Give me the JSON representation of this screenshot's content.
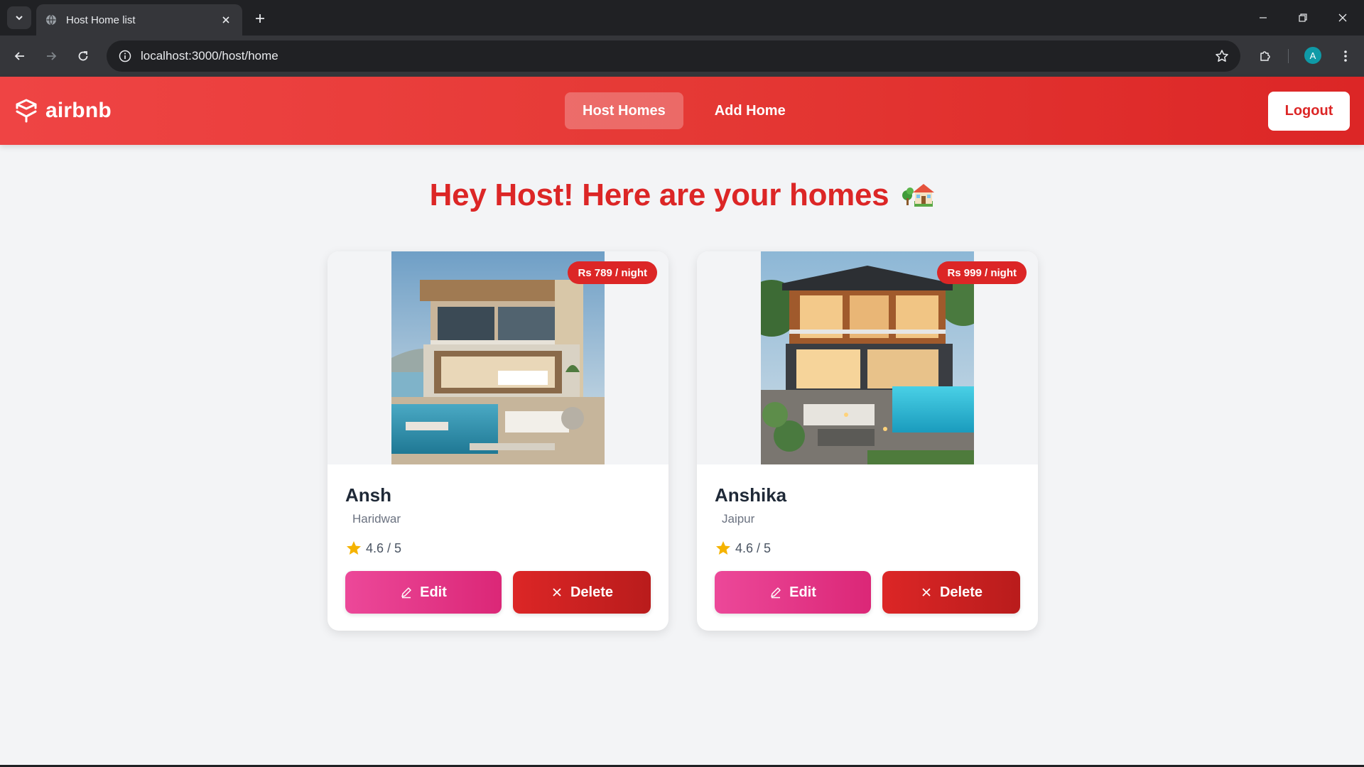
{
  "browser": {
    "tab_title": "Host Home list",
    "url": "localhost:3000/host/home",
    "profile_initial": "A"
  },
  "header": {
    "brand": "airbnb",
    "nav": [
      {
        "label": "Host Homes",
        "active": true
      },
      {
        "label": "Add Home",
        "active": false
      }
    ],
    "logout_label": "Logout"
  },
  "page": {
    "title": "Hey Host! Here are your homes",
    "title_emoji_icon": "house-with-garden-icon"
  },
  "homes": [
    {
      "name": "Ansh",
      "location": "Haridwar",
      "price_label": "Rs 789 / night",
      "rating_label": "4.6 / 5",
      "edit_label": "Edit",
      "delete_label": "Delete"
    },
    {
      "name": "Anshika",
      "location": "Jaipur",
      "price_label": "Rs 999 / night",
      "rating_label": "4.6 / 5",
      "edit_label": "Edit",
      "delete_label": "Delete"
    }
  ],
  "colors": {
    "brand_red": "#dc2626",
    "edit_pink": "#ec4899",
    "star_gold": "#f5b301"
  }
}
